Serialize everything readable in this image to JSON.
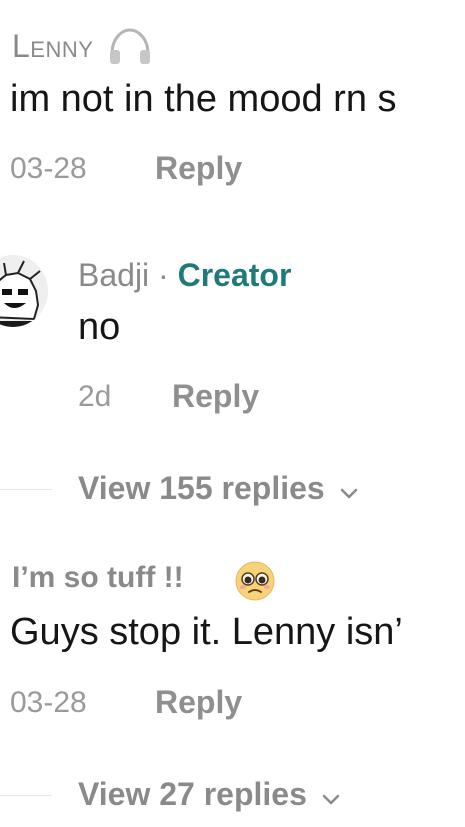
{
  "comment1": {
    "username": "Lenny",
    "headphones_icon": "headphones-icon",
    "text": "im not in the mood rn s",
    "date": "03-28",
    "reply_label": "Reply"
  },
  "reply1": {
    "username": "Badji",
    "separator": "·",
    "badge": "Creator",
    "text": "no",
    "date": "2d",
    "reply_label": "Reply"
  },
  "view1": {
    "label": "View 155 replies",
    "chevron_icon": "chevron-down-icon"
  },
  "comment2": {
    "username": "I’m so tuff !!",
    "emoji_icon": "pleading-face-icon",
    "text": "Guys stop it. Lenny isn’",
    "date": "03-28",
    "reply_label": "Reply"
  },
  "view2": {
    "label": "View 27 replies",
    "chevron_icon": "chevron-down-icon"
  },
  "colors": {
    "creator": "#1f7a7a",
    "text": "#161616",
    "muted": "#8a8a8a"
  }
}
